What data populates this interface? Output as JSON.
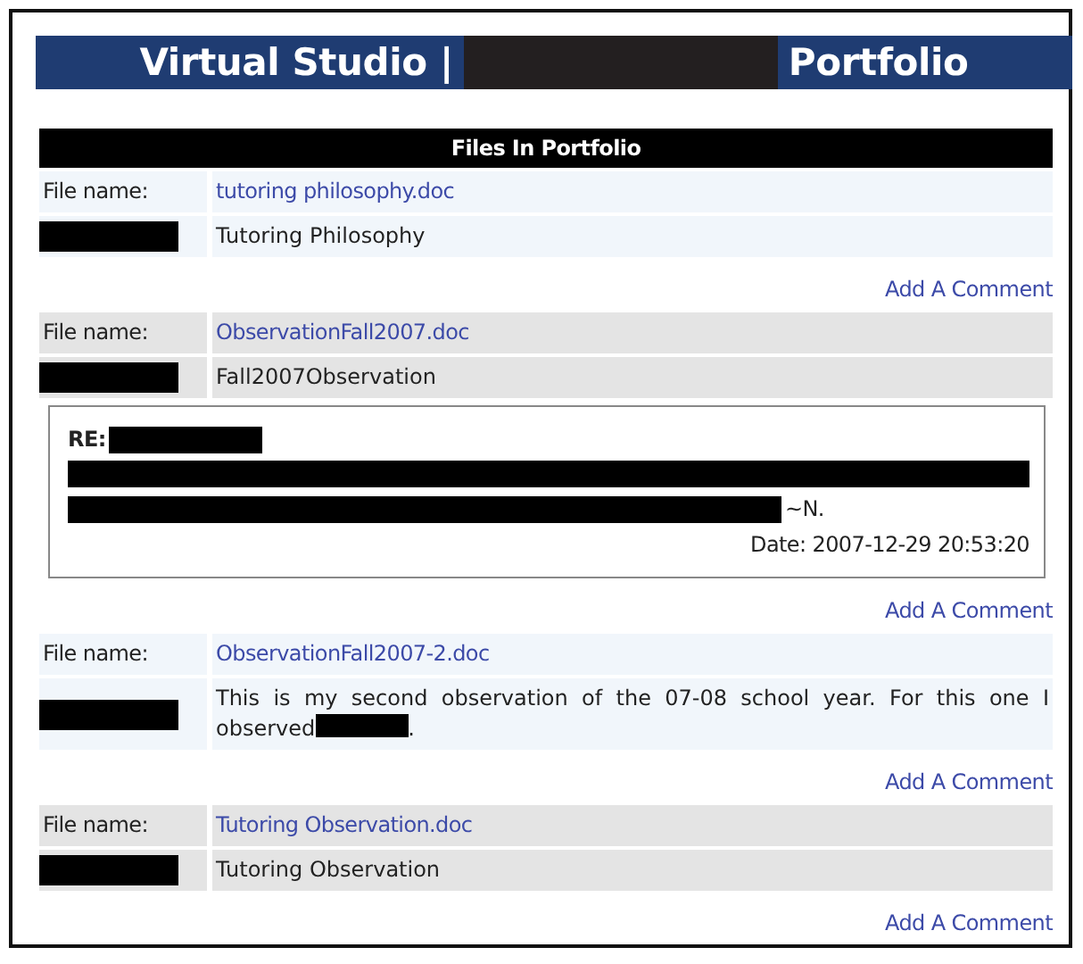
{
  "header": {
    "title": "Virtual Studio |",
    "title_end": "Portfolio"
  },
  "files_table": {
    "heading": "Files In Portfolio",
    "files": [
      {
        "label": "File name:",
        "filename": "tutoring philosophy.doc",
        "description": [
          {
            "kind": "text",
            "text": "Tutoring Philosophy"
          }
        ],
        "add_comment": "Add A Comment"
      },
      {
        "label": "File name:",
        "filename": "ObservationFall2007.doc",
        "description": [
          {
            "kind": "text",
            "text": "Fall2007Observation"
          }
        ],
        "comments": [
          {
            "re_label": "RE:",
            "signature": "~N.",
            "date": "Date: 2007-12-29 20:53:20"
          }
        ],
        "add_comment": "Add A Comment"
      },
      {
        "label": "File name:",
        "filename": "ObservationFall2007-2.doc",
        "description": [
          {
            "kind": "text",
            "text": "This is my second observation of the 07-08 school year. For this one I observed"
          },
          {
            "kind": "redacted"
          },
          {
            "kind": "text",
            "text": "."
          }
        ],
        "add_comment": "Add A Comment"
      },
      {
        "label": "File name:",
        "filename": "Tutoring Observation.doc",
        "description": [
          {
            "kind": "text",
            "text": "Tutoring Observation"
          }
        ],
        "add_comment": "Add A Comment"
      }
    ]
  }
}
